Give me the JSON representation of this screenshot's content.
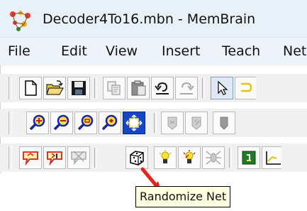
{
  "window": {
    "title": "Decoder4To16.mbn - MemBrain"
  },
  "menu": {
    "items": [
      "File",
      "Edit",
      "View",
      "Insert",
      "Teach",
      "Net"
    ]
  },
  "tooltip": {
    "text": "Randomize Net"
  },
  "colors": {
    "titlebar": "#e8f1f8",
    "toolbar": "#f0f0f0",
    "tooltip": "#ffffe1",
    "annotation_arrow": "#e8231b"
  },
  "toolbar_rows": [
    [
      "new-file-icon",
      "open-folder-icon",
      "save-icon",
      "copy-icon",
      "paste-icon",
      "undo-icon",
      "redo-icon",
      "select-pointer-icon",
      "link-icon"
    ],
    [
      "zoom-in-icon",
      "zoom-out-icon",
      "zoom-icon",
      "zoom-fit-icon",
      "zoom-all-icon",
      "neuron-disabled-icon",
      "neuron-disabled-2-icon",
      "neuron-gray-icon"
    ],
    [
      "add-output-neuron-icon",
      "add-input-neuron-icon",
      "delete-neuron-icon",
      "randomize-dice-icon",
      "bulb-icon",
      "bulb-red-icon",
      "spider-icon",
      "teach-icon",
      "chart-icon"
    ]
  ]
}
